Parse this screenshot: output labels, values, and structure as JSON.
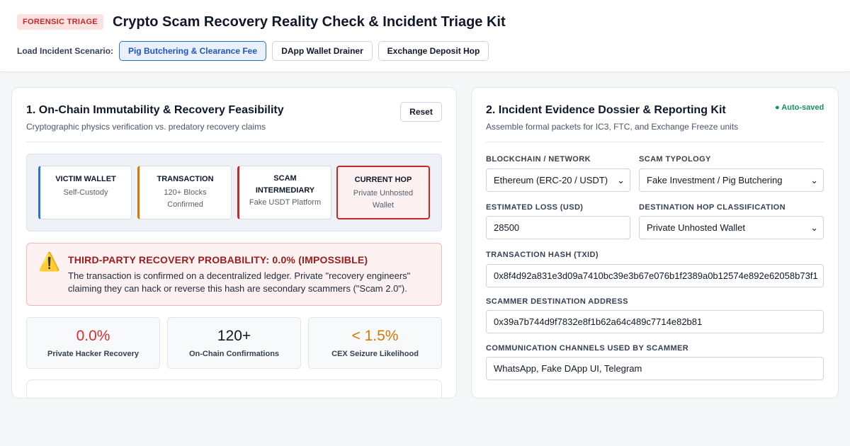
{
  "header": {
    "badge": "FORENSIC TRIAGE",
    "title": "Crypto Scam Recovery Reality Check & Incident Triage Kit",
    "scenario_label": "Load Incident Scenario:",
    "scenarios": [
      {
        "label": "Pig Butchering & Clearance Fee",
        "active": true
      },
      {
        "label": "DApp Wallet Drainer",
        "active": false
      },
      {
        "label": "Exchange Deposit Hop",
        "active": false
      }
    ]
  },
  "left_panel": {
    "title": "1. On-Chain Immutability & Recovery Feasibility",
    "subtitle": "Cryptographic physics verification vs. predatory recovery claims",
    "reset_label": "Reset",
    "chain": [
      {
        "title": "VICTIM WALLET",
        "sub": "Self-Custody",
        "accent": "#2f6fdb"
      },
      {
        "title": "TRANSACTION",
        "sub": "120+ Blocks Confirmed",
        "accent": "#d97706"
      },
      {
        "title": "SCAM INTERMEDIARY",
        "sub": "Fake USDT Platform",
        "accent": "#c62828"
      },
      {
        "title": "CURRENT HOP",
        "sub": "Private Unhosted Wallet",
        "accent": "#c62828"
      }
    ],
    "alert": {
      "icon": "warning-icon",
      "glyph": "⚠️",
      "title": "THIRD-PARTY RECOVERY PROBABILITY: 0.0% (IMPOSSIBLE)",
      "body": "The transaction is confirmed on a decentralized ledger. Private \"recovery engineers\" claiming they can hack or reverse this hash are secondary scammers (\"Scam 2.0\")."
    },
    "stats": [
      {
        "value": "0.0%",
        "label": "Private Hacker Recovery",
        "color": "#d32f2f"
      },
      {
        "value": "120+",
        "label": "On-Chain Confirmations",
        "color": "#111827"
      },
      {
        "value": "< 1.5%",
        "label": "CEX Seizure Likelihood",
        "color": "#d97706"
      }
    ]
  },
  "right_panel": {
    "title": "2. Incident Evidence Dossier & Reporting Kit",
    "subtitle": "Assemble formal packets for IC3, FTC, and Exchange Freeze units",
    "autosave": "● Auto-saved",
    "fields": {
      "network": {
        "label": "BLOCKCHAIN / NETWORK",
        "value": "Ethereum (ERC-20 / USDT)"
      },
      "typology": {
        "label": "SCAM TYPOLOGY",
        "value": "Fake Investment / Pig Butchering"
      },
      "loss": {
        "label": "ESTIMATED LOSS (USD)",
        "value": "28500"
      },
      "hop_class": {
        "label": "DESTINATION HOP CLASSIFICATION",
        "value": "Private Unhosted Wallet"
      },
      "txid": {
        "label": "TRANSACTION HASH (TXID)",
        "value": "0x8f4d92a831e3d09a7410bc39e3b67e076b1f2389a0b12574e892e62058b73f1"
      },
      "scam_address": {
        "label": "SCAMMER DESTINATION ADDRESS",
        "value": "0x39a7b744d9f7832e8f1b62a64c489c7714e82b81"
      },
      "channels": {
        "label": "COMMUNICATION CHANNELS USED BY SCAMMER",
        "value": "WhatsApp, Fake DApp UI, Telegram"
      }
    }
  }
}
